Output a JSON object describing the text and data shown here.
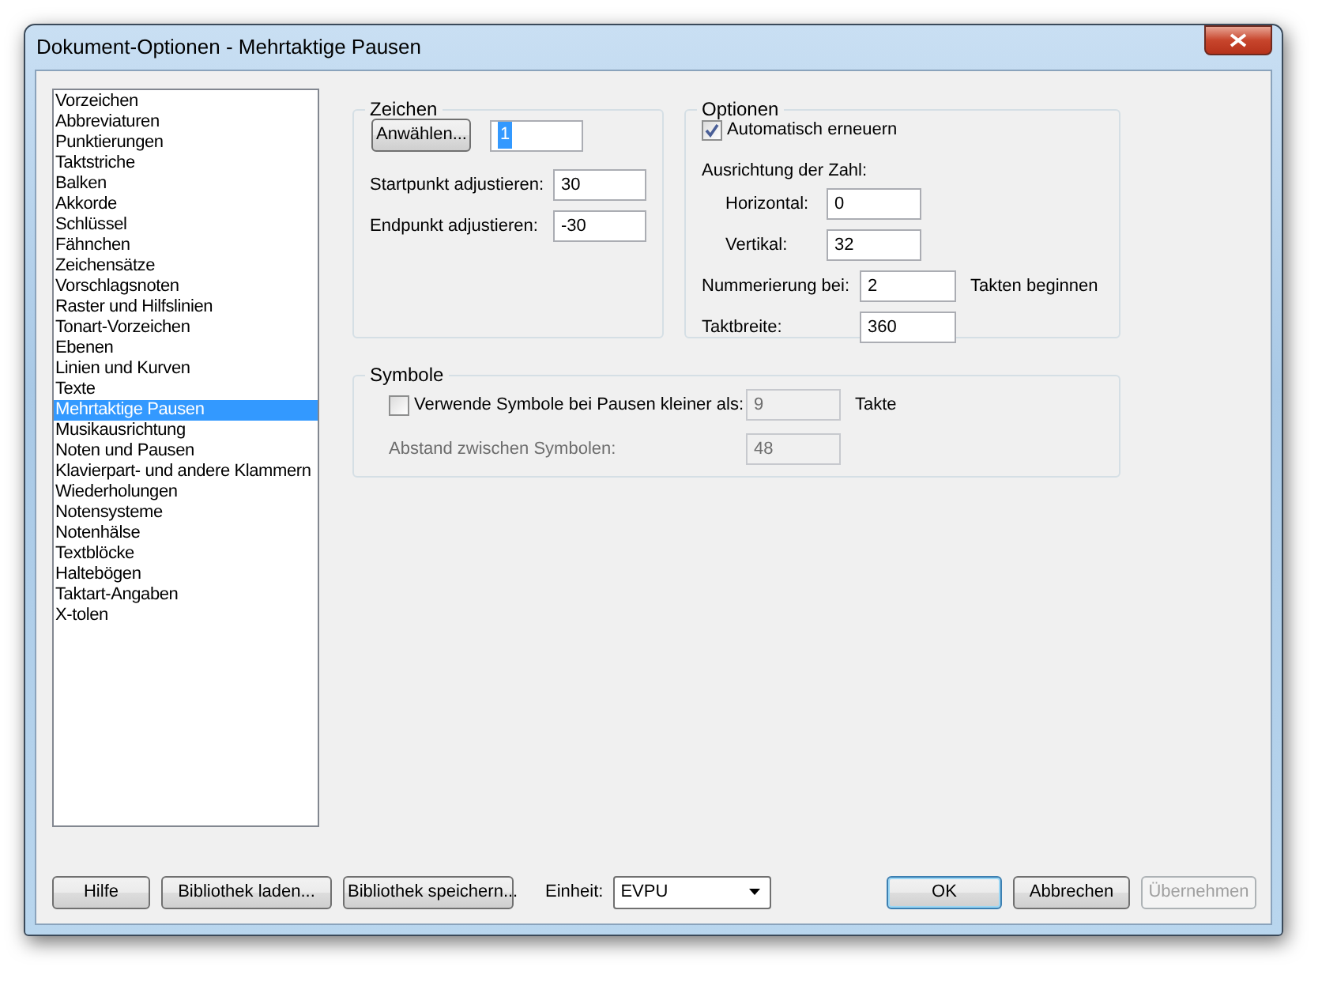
{
  "window": {
    "title": "Dokument-Optionen - Mehrtaktige Pausen"
  },
  "sidebar": {
    "items": [
      {
        "label": "Vorzeichen",
        "selected": false
      },
      {
        "label": "Abbreviaturen",
        "selected": false
      },
      {
        "label": "Punktierungen",
        "selected": false
      },
      {
        "label": "Taktstriche",
        "selected": false
      },
      {
        "label": "Balken",
        "selected": false
      },
      {
        "label": "Akkorde",
        "selected": false
      },
      {
        "label": "Schlüssel",
        "selected": false
      },
      {
        "label": "Fähnchen",
        "selected": false
      },
      {
        "label": "Zeichensätze",
        "selected": false
      },
      {
        "label": "Vorschlagsnoten",
        "selected": false
      },
      {
        "label": "Raster und Hilfslinien",
        "selected": false
      },
      {
        "label": "Tonart-Vorzeichen",
        "selected": false
      },
      {
        "label": "Ebenen",
        "selected": false
      },
      {
        "label": "Linien und Kurven",
        "selected": false
      },
      {
        "label": "Texte",
        "selected": false
      },
      {
        "label": "Mehrtaktige Pausen",
        "selected": true
      },
      {
        "label": "Musikausrichtung",
        "selected": false
      },
      {
        "label": "Noten und Pausen",
        "selected": false
      },
      {
        "label": "Klavierpart- und andere Klammern",
        "selected": false
      },
      {
        "label": "Wiederholungen",
        "selected": false
      },
      {
        "label": "Notensysteme",
        "selected": false
      },
      {
        "label": "Notenhälse",
        "selected": false
      },
      {
        "label": "Textblöcke",
        "selected": false
      },
      {
        "label": "Haltebögen",
        "selected": false
      },
      {
        "label": "Taktart-Angaben",
        "selected": false
      },
      {
        "label": "X-tolen",
        "selected": false
      }
    ]
  },
  "zeichen": {
    "title": "Zeichen",
    "select_button": "Anwählen...",
    "character": {
      "value": "1",
      "highlighted": true
    },
    "fields": [
      {
        "label": "Startpunkt adjustieren:",
        "value": "30"
      },
      {
        "label": "Endpunkt adjustieren:",
        "value": "-30"
      }
    ]
  },
  "optionen": {
    "title": "Optionen",
    "auto_renew": {
      "label": "Automatisch erneuern",
      "checked": true
    },
    "alignment_label": "Ausrichtung der Zahl:",
    "alignment_fields": [
      {
        "label": "Horizontal:",
        "value": "0"
      },
      {
        "label": "Vertikal:",
        "value": "32"
      }
    ],
    "numbering": {
      "label": "Nummerierung bei:",
      "value": "2",
      "suffix": "Takten beginnen"
    },
    "measure_width": {
      "label": "Taktbreite:",
      "value": "360"
    }
  },
  "symbole": {
    "title": "Symbole",
    "use_symbols": {
      "label": "Verwende Symbole bei Pausen kleiner als:",
      "checked": false,
      "value": "9",
      "disabled": true,
      "suffix": "Takte"
    },
    "spacing": {
      "label": "Abstand zwischen Symbolen:",
      "value": "48",
      "disabled": true
    }
  },
  "footer": {
    "buttons": [
      {
        "label": "Hilfe",
        "disabled": false,
        "default": false
      },
      {
        "label": "Bibliothek laden...",
        "disabled": false,
        "default": false
      },
      {
        "label": "Bibliothek speichern...",
        "disabled": false,
        "default": false
      }
    ],
    "unit": {
      "label": "Einheit:",
      "value": "EVPU"
    },
    "actions": [
      {
        "label": "OK",
        "disabled": false,
        "default": true
      },
      {
        "label": "Abbrechen",
        "disabled": false,
        "default": false
      },
      {
        "label": "Übernehmen",
        "disabled": true,
        "default": false
      }
    ]
  }
}
